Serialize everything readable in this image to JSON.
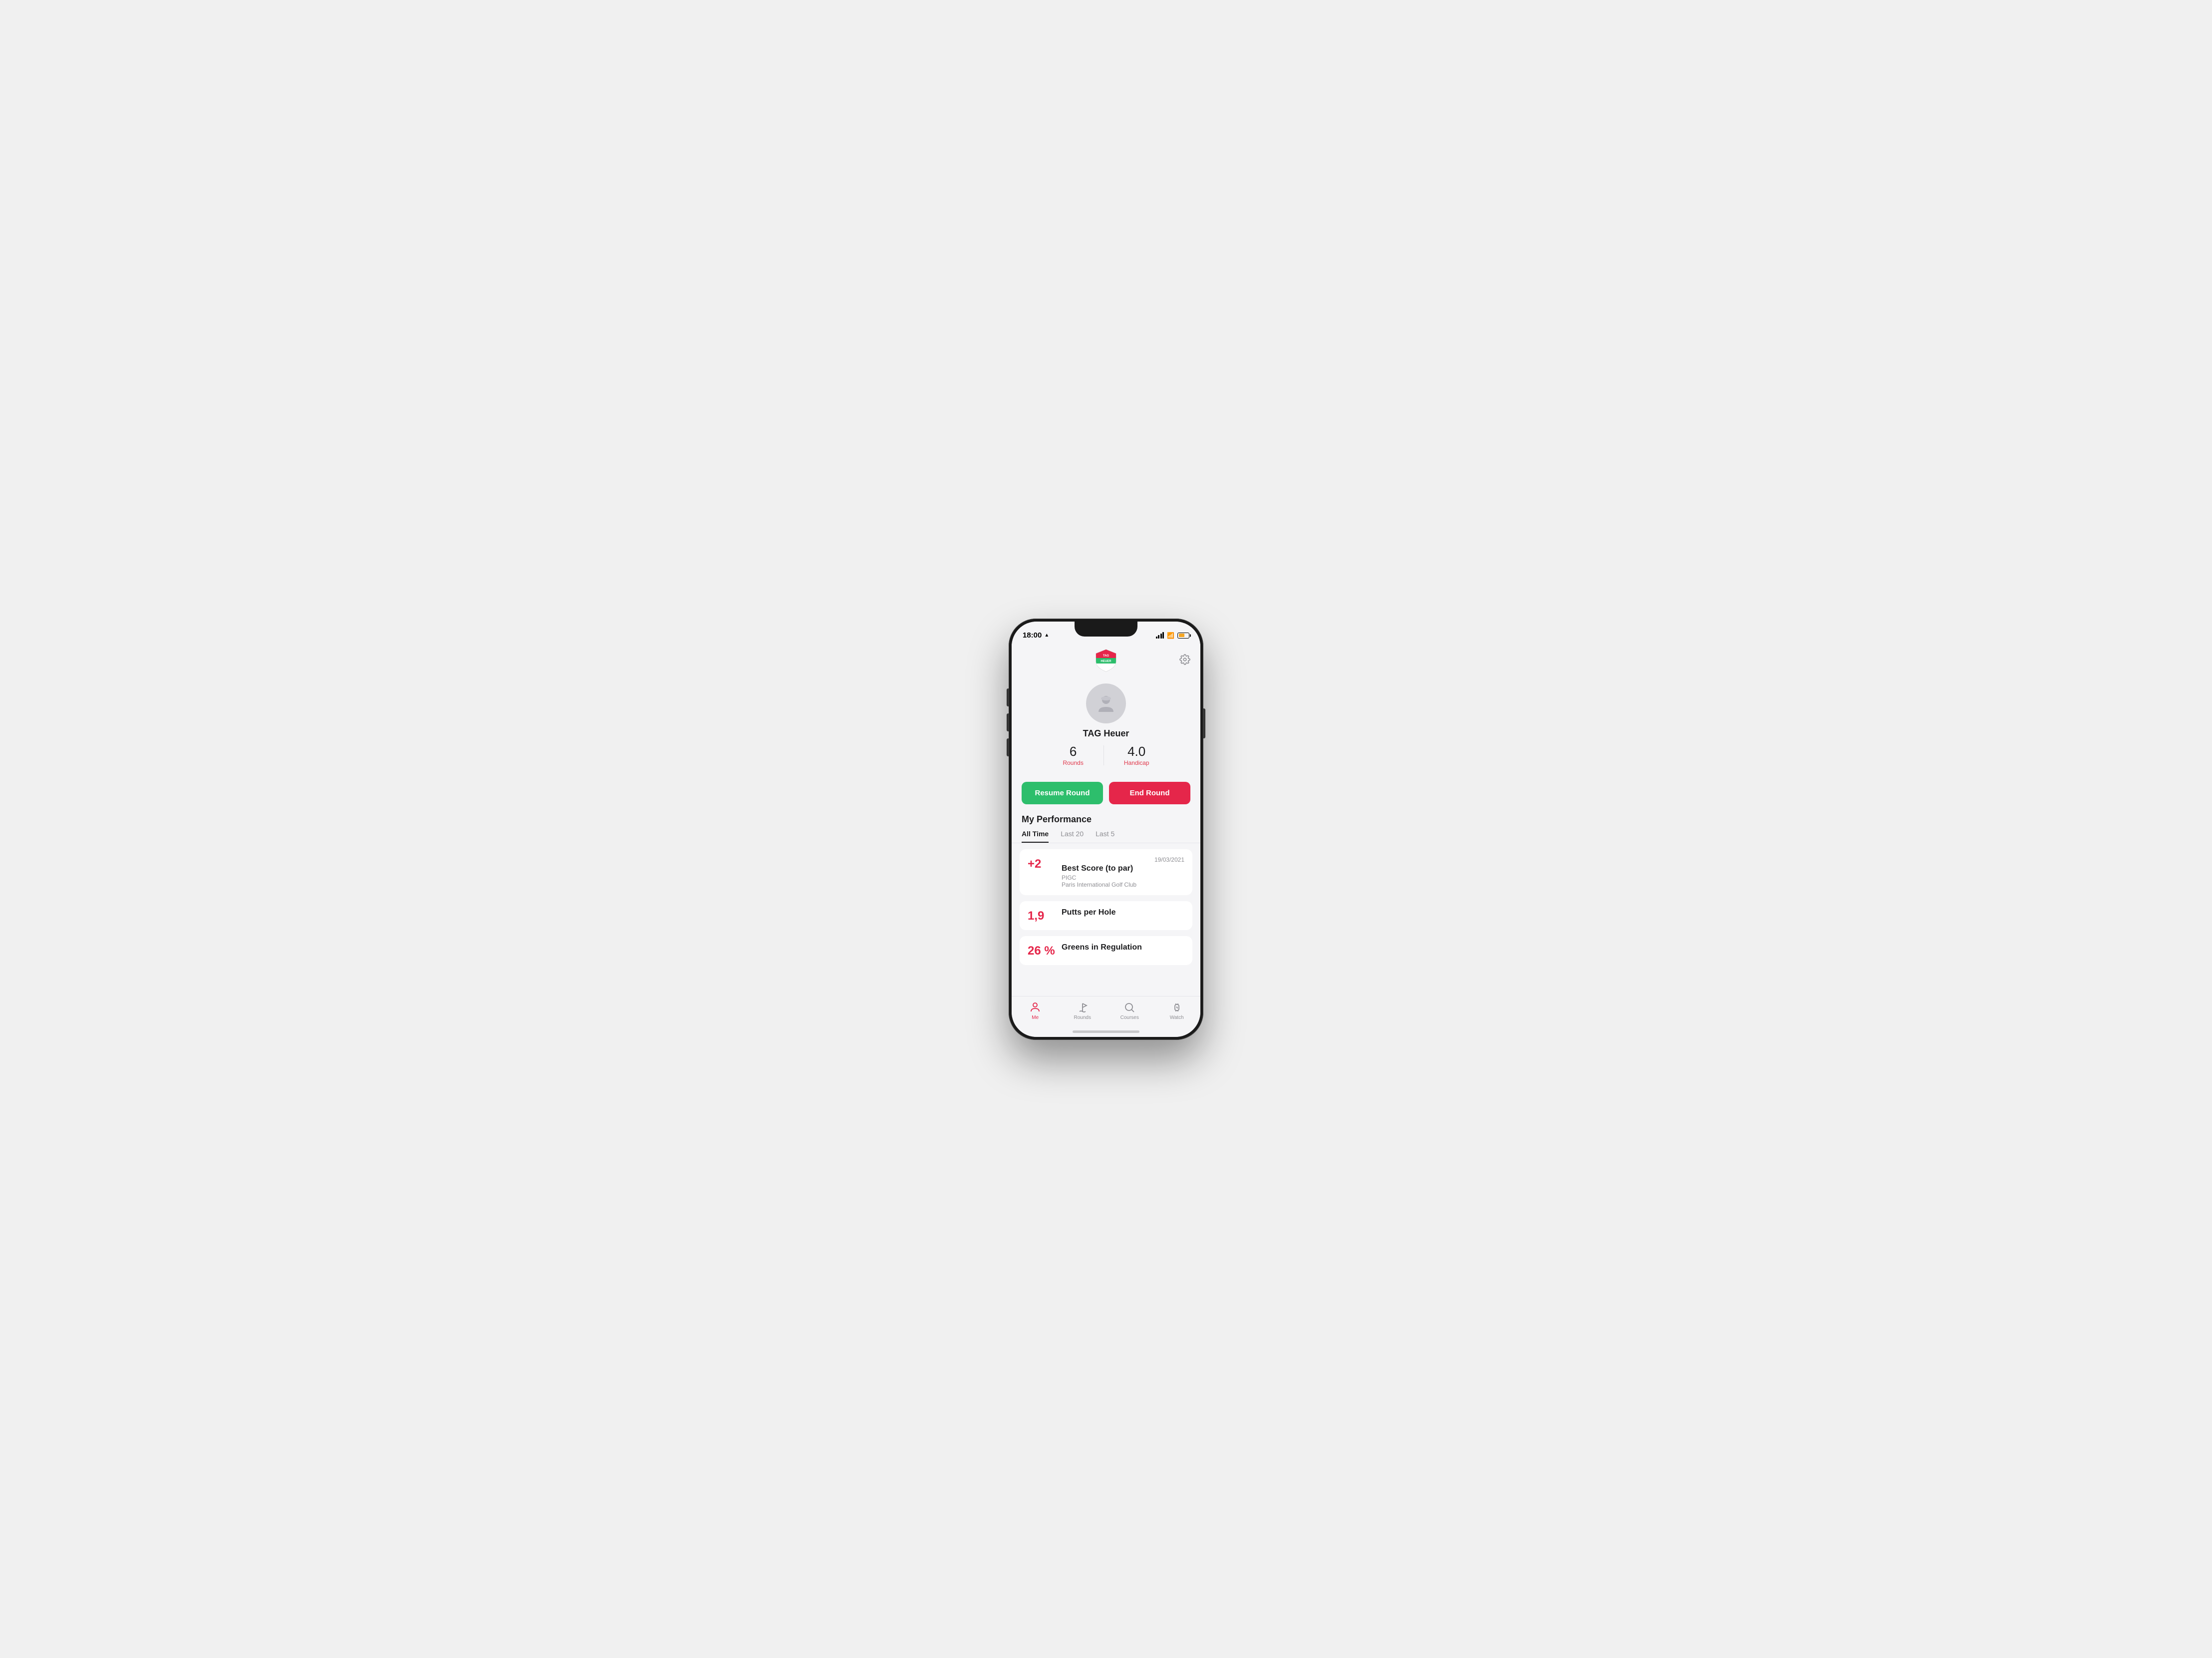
{
  "statusBar": {
    "time": "18:00",
    "locationIcon": "▲"
  },
  "header": {
    "settingsTooltip": "Settings"
  },
  "profile": {
    "name": "TAG Heuer",
    "avatarAlt": "Golf player avatar"
  },
  "stats": {
    "rounds": {
      "value": "6",
      "label": "Rounds"
    },
    "handicap": {
      "value": "4.0",
      "label": "Handicap"
    }
  },
  "buttons": {
    "resumeRound": "Resume Round",
    "endRound": "End Round"
  },
  "performance": {
    "sectionTitle": "My Performance",
    "tabs": [
      {
        "label": "All Time",
        "active": true
      },
      {
        "label": "Last 20",
        "active": false
      },
      {
        "label": "Last 5",
        "active": false
      }
    ],
    "cards": [
      {
        "value": "+2",
        "date": "19/03/2021",
        "title": "Best Score (to par)",
        "subtitle": "PIGC",
        "subtitleDetail": "Paris International Golf Club"
      },
      {
        "value": "1,9",
        "date": "",
        "title": "Putts per Hole",
        "subtitle": "",
        "subtitleDetail": ""
      },
      {
        "value": "26 %",
        "date": "",
        "title": "Greens in Regulation",
        "subtitle": "",
        "subtitleDetail": ""
      }
    ]
  },
  "bottomNav": {
    "items": [
      {
        "id": "me",
        "label": "Me",
        "active": true,
        "icon": "person"
      },
      {
        "id": "rounds",
        "label": "Rounds",
        "active": false,
        "icon": "flag"
      },
      {
        "id": "courses",
        "label": "Courses",
        "active": false,
        "icon": "search"
      },
      {
        "id": "watch",
        "label": "Watch",
        "active": false,
        "icon": "watch"
      }
    ]
  }
}
